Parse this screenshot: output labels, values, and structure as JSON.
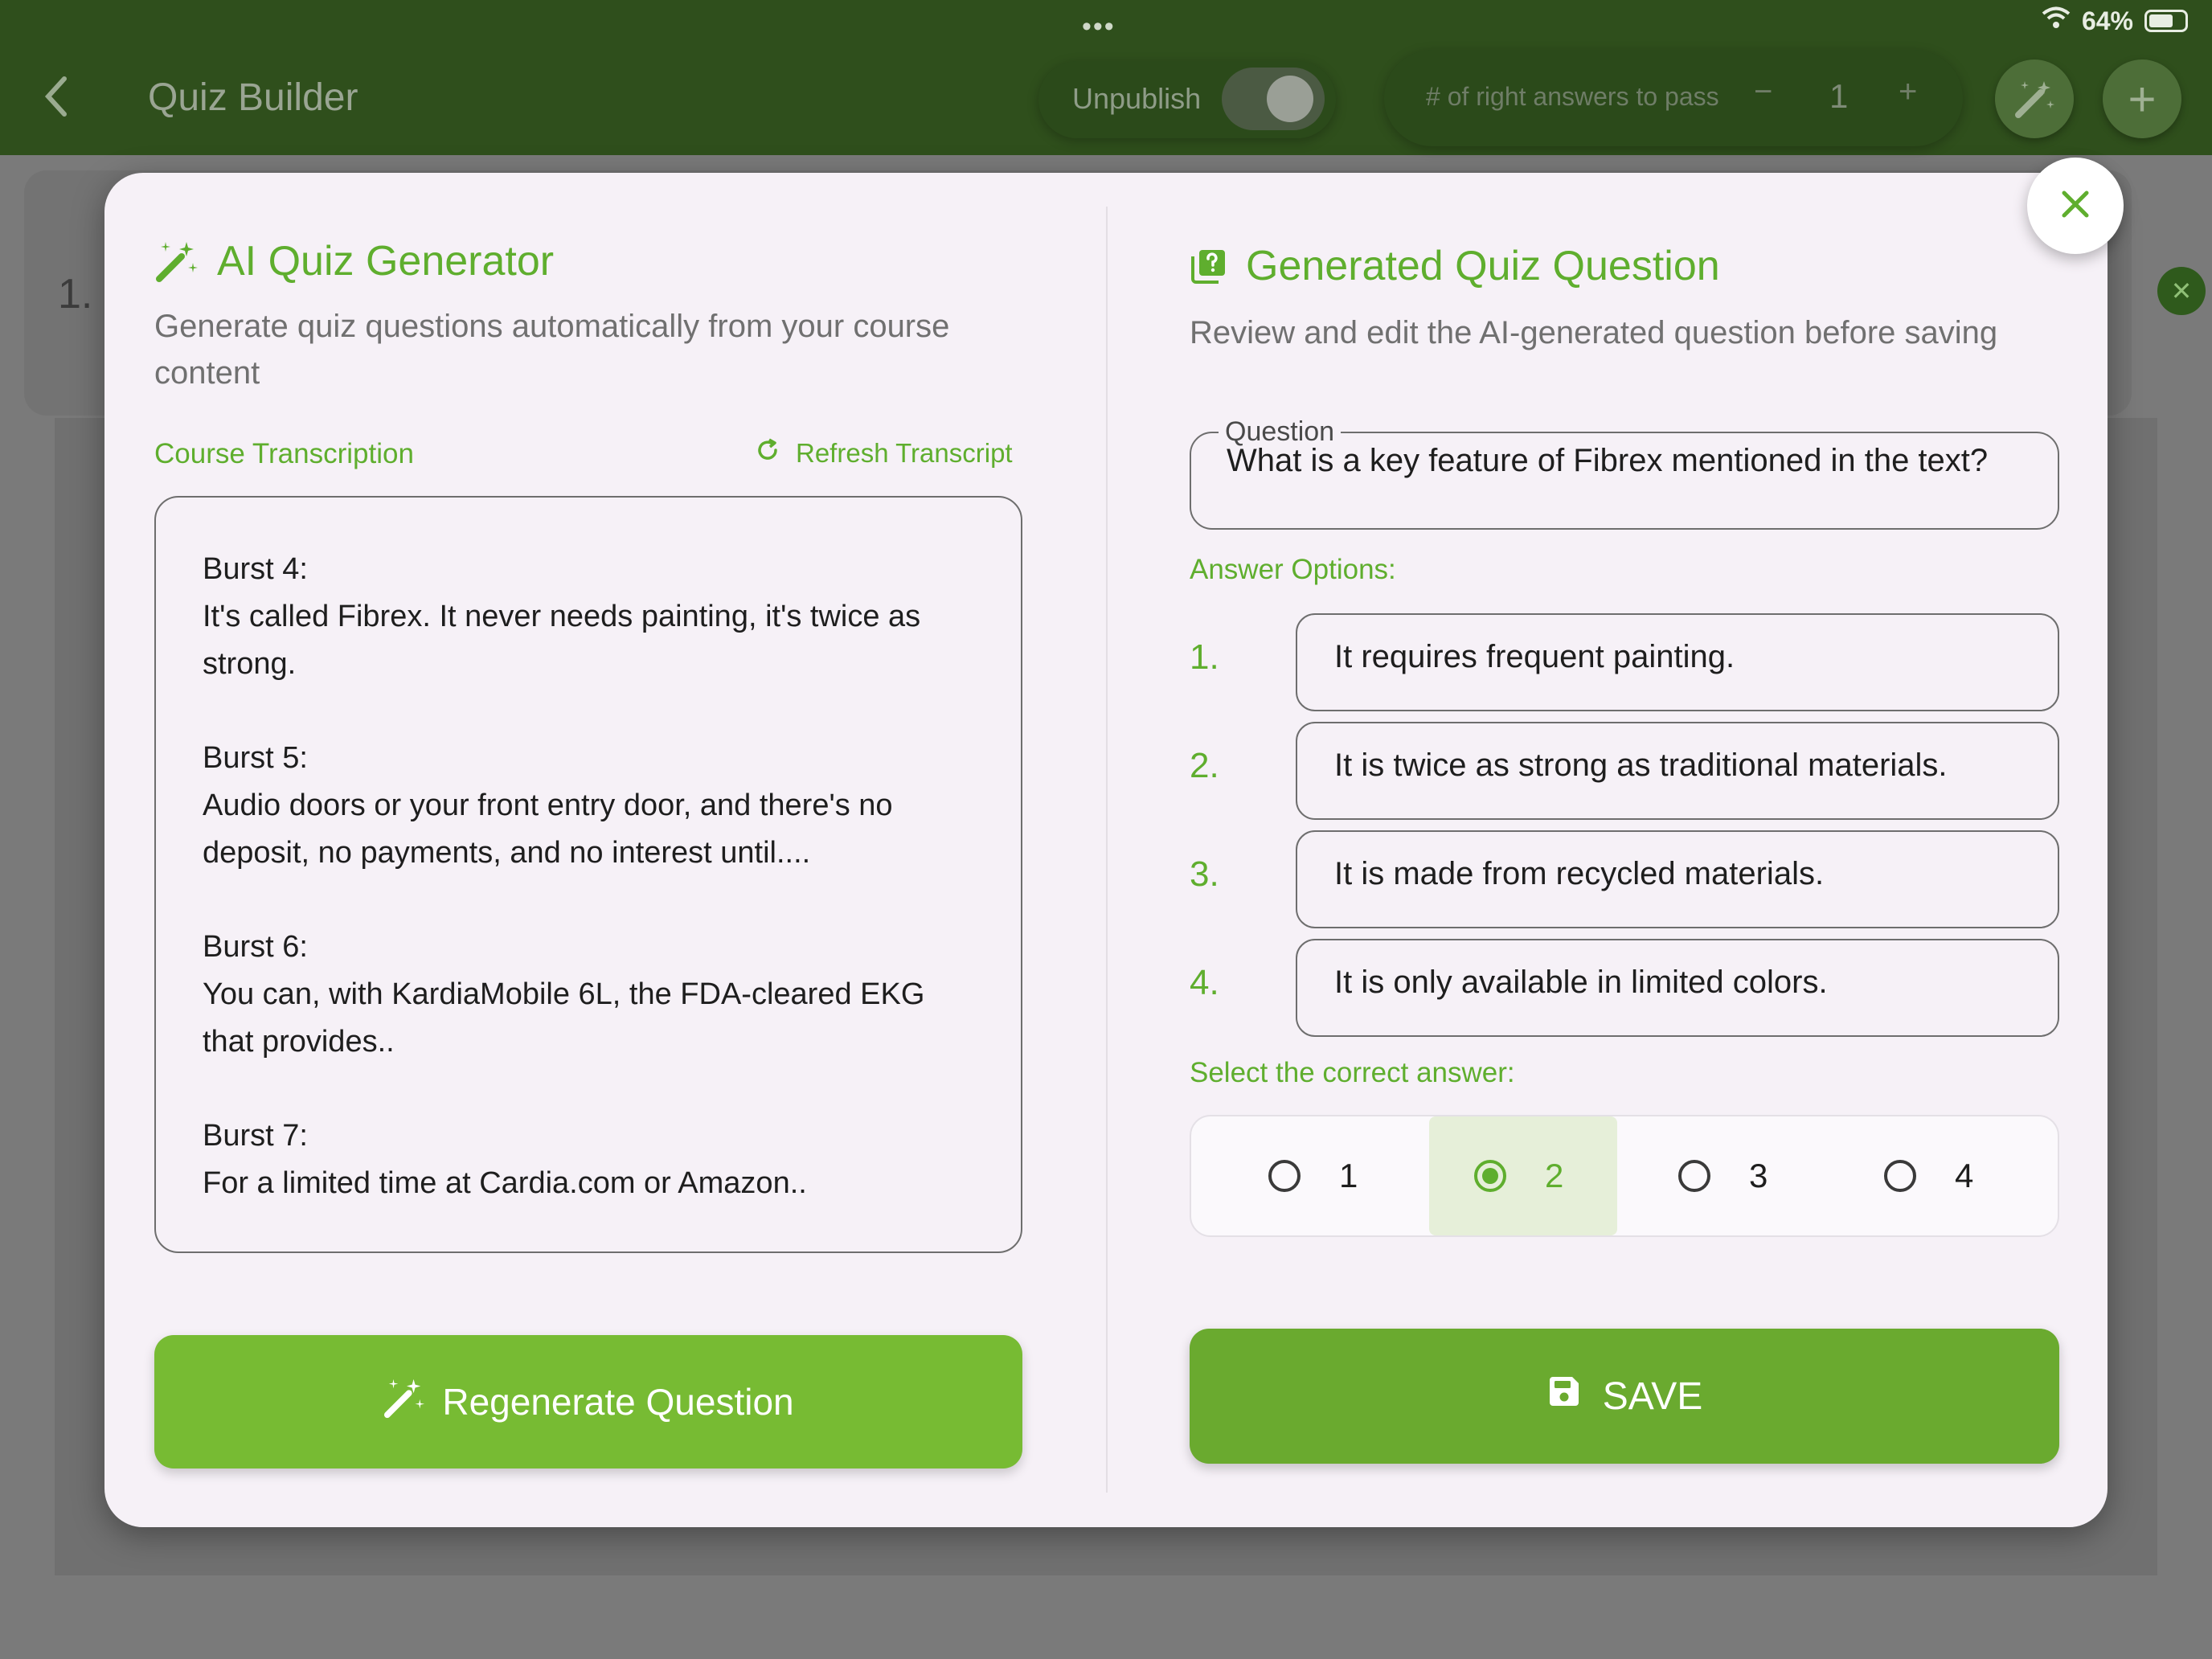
{
  "status_bar": {
    "dots": "•••",
    "battery": "64%"
  },
  "header": {
    "title": "Quiz Builder",
    "unpublish_label": "Unpublish",
    "pass_label": "# of right answers to pass",
    "pass_minus": "−",
    "pass_value": "1",
    "pass_plus": "+",
    "add_label": "+"
  },
  "background": {
    "question_number": "1."
  },
  "generator": {
    "title": "AI Quiz Generator",
    "subtitle": "Generate quiz questions automatically from your course content",
    "transcription_label": "Course Transcription",
    "refresh_label": "Refresh Transcript",
    "bursts": [
      {
        "title": "Burst 4:",
        "text": "It's called Fibrex. It never needs painting, it's twice as strong."
      },
      {
        "title": "Burst 5:",
        "text": "Audio doors or your front entry door, and there's no deposit, no payments, and no interest until...."
      },
      {
        "title": "Burst 6:",
        "text": "You can, with KardiaMobile 6L, the FDA-cleared EKG that provides.."
      },
      {
        "title": "Burst 7:",
        "text": "For a limited time at Cardia.com or Amazon.."
      }
    ],
    "regenerate_label": "Regenerate Question"
  },
  "generated": {
    "title": "Generated Quiz Question",
    "subtitle": "Review and edit the AI-generated question before saving",
    "question_legend": "Question",
    "question_text": "What is a key feature of Fibrex mentioned in the text?",
    "answers_label": "Answer Options:",
    "options": [
      {
        "num": "1.",
        "text": "It requires frequent painting."
      },
      {
        "num": "2.",
        "text": "It is twice as strong as traditional materials."
      },
      {
        "num": "3.",
        "text": "It is made from recycled materials."
      },
      {
        "num": "4.",
        "text": "It is only available in limited colors."
      }
    ],
    "select_label": "Select the correct answer:",
    "radios": [
      "1",
      "2",
      "3",
      "4"
    ],
    "selected_answer": "2",
    "save_label": "SAVE"
  },
  "colors": {
    "accent": "#5fae2e",
    "button": "#77bb33",
    "save": "#6aaa2f",
    "topbar": "#2f4f1c"
  }
}
